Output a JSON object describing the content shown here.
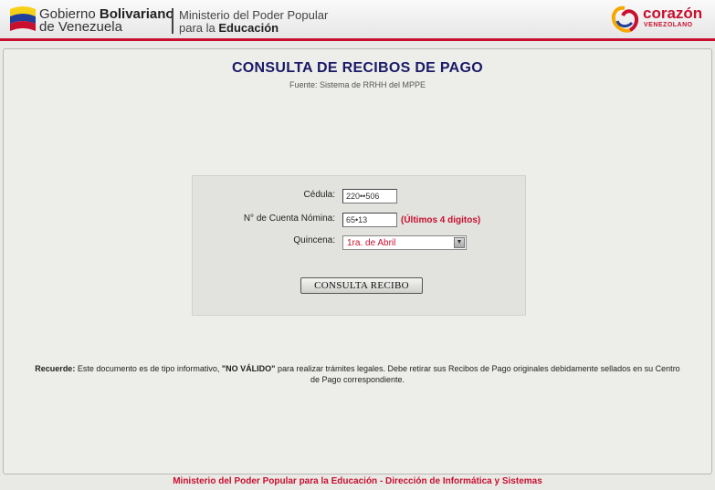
{
  "header": {
    "gov_line1_plain": "Gobierno ",
    "gov_line1_bold": "Bolivariano",
    "gov_line2": "de Venezuela",
    "ministry_line1": "Ministerio del Poder Popular",
    "ministry_line2_plain": "para la ",
    "ministry_line2_bold": "Educación",
    "logo_text": "corazón",
    "logo_sub": "VENEZOLANO",
    "colors": {
      "accent": "#c8102e",
      "title": "#1a1a66"
    }
  },
  "main": {
    "title": "CONSULTA DE RECIBOS DE PAGO",
    "subtitle": "Fuente: Sistema de RRHH del MPPE"
  },
  "form": {
    "cedula_label": "Cédula:",
    "cedula_value": "220••506",
    "cuenta_label": "N° de Cuenta Nómina:",
    "cuenta_value": "65•13",
    "cuenta_hint": "(Últimos 4 digitos)",
    "quincena_label": "Quincena:",
    "quincena_selected": "1ra. de Abril",
    "submit_label": "CONSULTA RECIBO"
  },
  "notice": {
    "bold_prefix": "Recuerde:",
    "text_part1": " Este documento es de tipo informativo, ",
    "bold_mid": "\"NO VÁLIDO\"",
    "text_part2": " para realizar trámites legales. Debe retirar sus Recibos de Pago originales debidamente sellados en su Centro de Pago correspondiente."
  },
  "footer": {
    "text": "Ministerio del Poder Popular para la Educación - Dirección de Informática y Sistemas"
  }
}
